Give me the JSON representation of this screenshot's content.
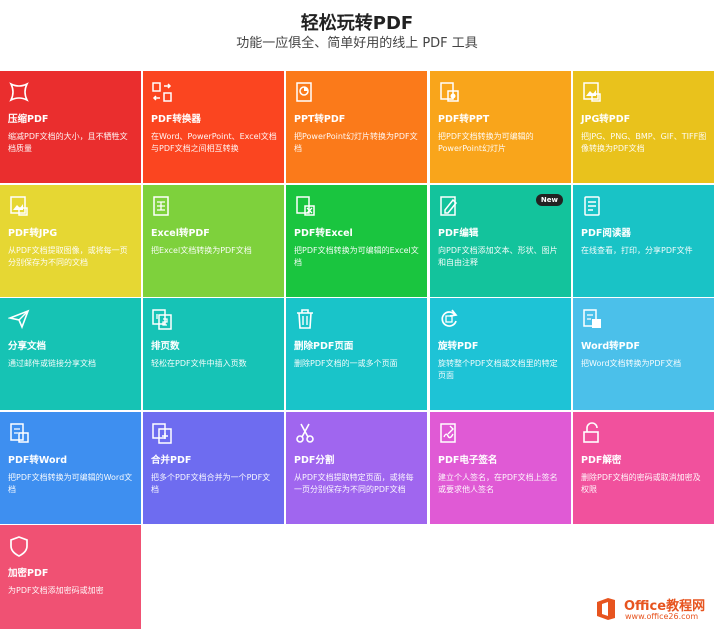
{
  "header": {
    "title": "轻松玩转PDF",
    "subtitle": "功能一应俱全、简单好用的线上 PDF 工具"
  },
  "tiles": [
    {
      "name": "压缩PDF",
      "desc": "缩减PDF文档的大小，且不牺牲文档质量",
      "color": "#ea2e2e",
      "icon": "compress-icon"
    },
    {
      "name": "PDF转换器",
      "desc": "在Word、PowerPoint、Excel文档与PDF文档之间相互转换",
      "color": "#fb4520",
      "icon": "convert-icon"
    },
    {
      "name": "PPT转PDF",
      "desc": "把PowerPoint幻灯片转换为PDF文档",
      "color": "#fb7a1a",
      "icon": "ppt-icon"
    },
    {
      "name": "PDF转PPT",
      "desc": "把PDF文档转换为可编辑的PowerPoint幻灯片",
      "color": "#f9a51b",
      "icon": "pdf-ppt-icon"
    },
    {
      "name": "JPG转PDF",
      "desc": "把JPG、PNG、BMP、GIF、TIFF图像转换为PDF文档",
      "color": "#e9c21c",
      "icon": "image-icon"
    },
    {
      "name": "PDF转JPG",
      "desc": "从PDF文档提取图像，或将每一页分别保存为不同的文档",
      "color": "#e6d733",
      "icon": "pdf-image-icon"
    },
    {
      "name": "Excel转PDF",
      "desc": "把Excel文档转换为PDF文档",
      "color": "#7ed13c",
      "icon": "excel-icon"
    },
    {
      "name": "PDF转Excel",
      "desc": "把PDF文档转换为可编辑的Excel文档",
      "color": "#1ac53f",
      "icon": "pdf-excel-icon"
    },
    {
      "name": "PDF编辑",
      "desc": "向PDF文档添加文本、形状、图片和自由注释",
      "color": "#13c39c",
      "icon": "edit-icon",
      "badge": "New"
    },
    {
      "name": "PDF阅读器",
      "desc": "在线查看，打印，分享PDF文件",
      "color": "#19c3c6",
      "icon": "reader-icon"
    },
    {
      "name": "分享文档",
      "desc": "通过邮件或链接分享文档",
      "color": "#16c3b4",
      "icon": "share-icon"
    },
    {
      "name": "排页数",
      "desc": "轻松在PDF文件中插入页数",
      "color": "#16c3b6",
      "icon": "page-number-icon"
    },
    {
      "name": "删除PDF页面",
      "desc": "删除PDF文档的一或多个页面",
      "color": "#19c4c9",
      "icon": "trash-icon"
    },
    {
      "name": "旋转PDF",
      "desc": "旋转整个PDF文档或文档里的特定页面",
      "color": "#1ec3d6",
      "icon": "rotate-icon"
    },
    {
      "name": "Word转PDF",
      "desc": "把Word文档转换为PDF文档",
      "color": "#4bc0ea",
      "icon": "word-icon"
    },
    {
      "name": "PDF转Word",
      "desc": "把PDF文档转换为可编辑的Word文档",
      "color": "#3e8ff0",
      "icon": "pdf-word-icon"
    },
    {
      "name": "合并PDF",
      "desc": "把多个PDF文档合并为一个PDF文档",
      "color": "#6e6cf0",
      "icon": "merge-icon"
    },
    {
      "name": "PDF分割",
      "desc": "从PDF文档提取特定页面，或将每一页分别保存为不同的PDF文档",
      "color": "#a066ef",
      "icon": "scissors-icon"
    },
    {
      "name": "PDF电子签名",
      "desc": "建立个人签名，在PDF文档上签名或要求他人签名",
      "color": "#e05ad5",
      "icon": "sign-icon"
    },
    {
      "name": "PDF解密",
      "desc": "删除PDF文档的密码或取消加密及权限",
      "color": "#f1519d",
      "icon": "unlock-icon"
    },
    {
      "name": "加密PDF",
      "desc": "为PDF文档添加密码或加密",
      "color": "#f05173",
      "icon": "shield-icon"
    }
  ],
  "watermark": {
    "title": "Office教程网",
    "url": "www.office26.com"
  }
}
